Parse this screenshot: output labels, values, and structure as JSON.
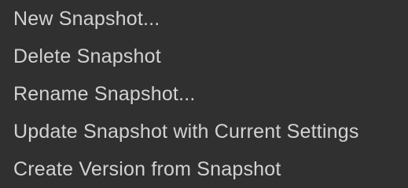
{
  "menu": {
    "items": [
      {
        "label": "New Snapshot..."
      },
      {
        "label": "Delete Snapshot"
      },
      {
        "label": "Rename Snapshot..."
      },
      {
        "label": "Update Snapshot with Current Settings"
      },
      {
        "label": "Create Version from Snapshot"
      }
    ]
  }
}
